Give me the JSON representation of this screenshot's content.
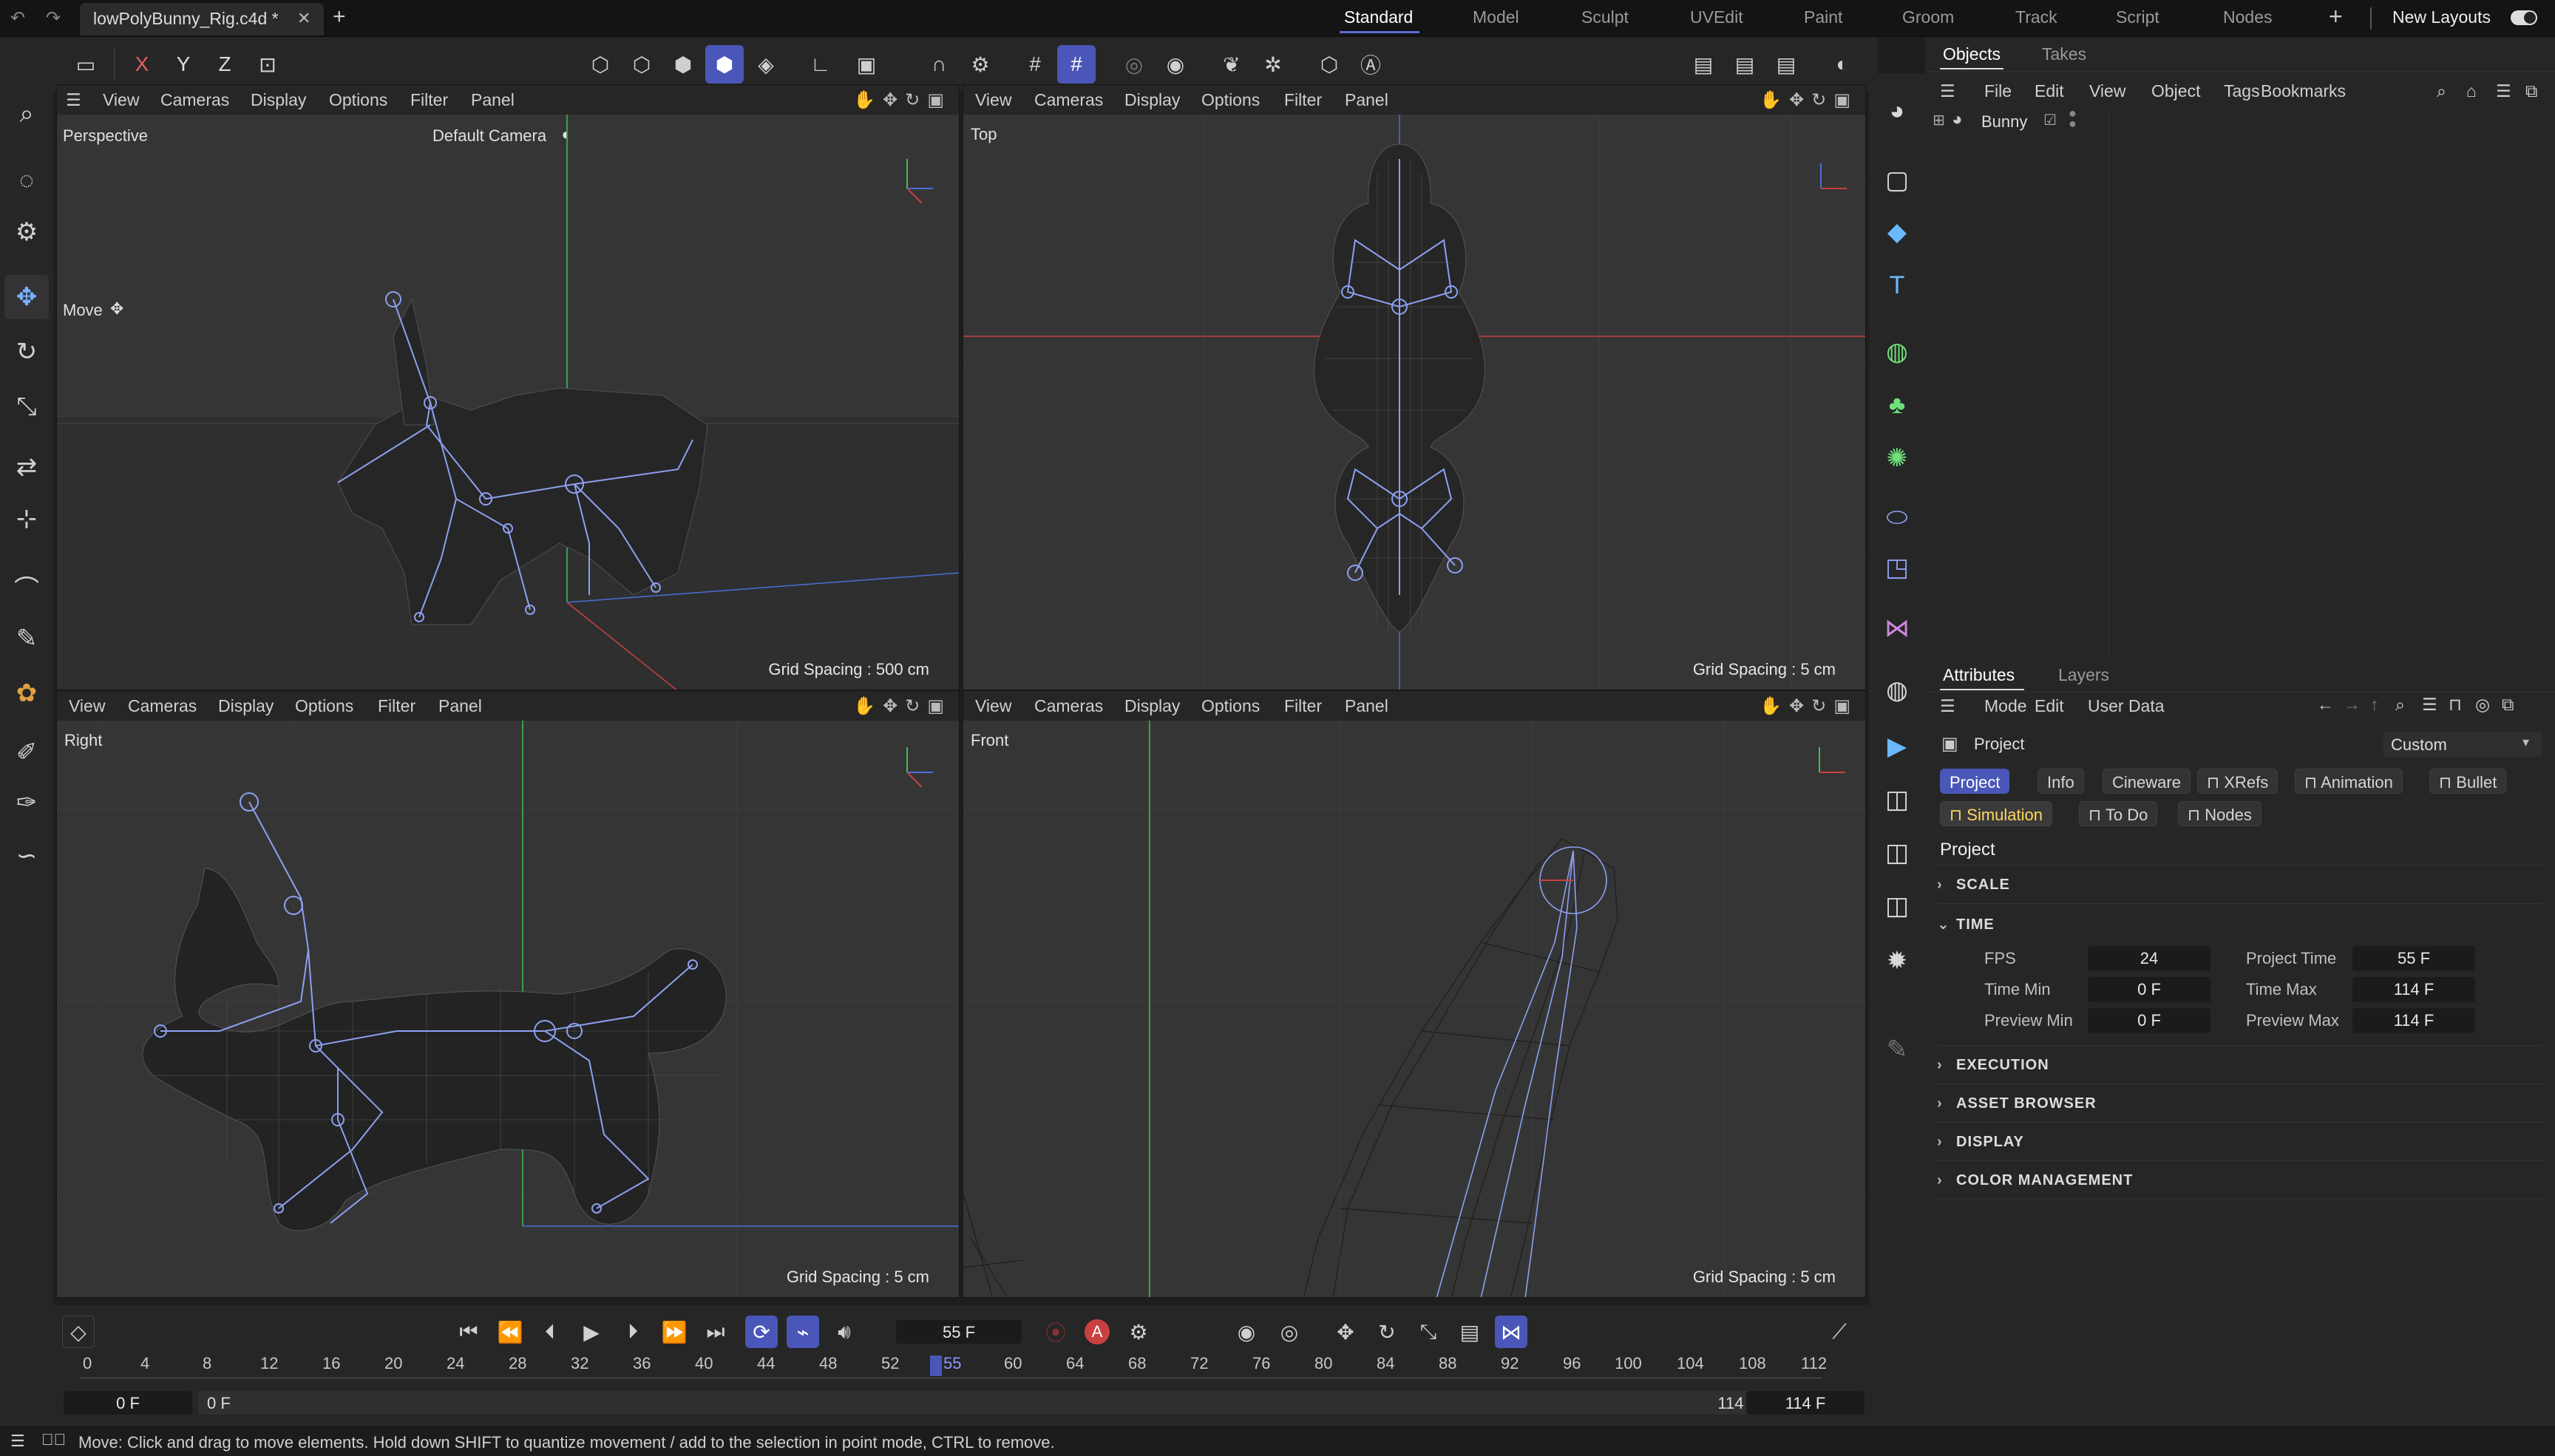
{
  "titlebar": {
    "doc_title": "lowPolyBunny_Rig.c4d *",
    "layouts": [
      "Standard",
      "Model",
      "Sculpt",
      "UVEdit",
      "Paint",
      "Groom",
      "Track",
      "Script",
      "Nodes"
    ],
    "active_layout": "Standard",
    "new_layouts_label": "New Layouts"
  },
  "toolbar": {
    "axes": [
      "X",
      "Y",
      "Z"
    ]
  },
  "left_tools": [
    "search-icon",
    "select-icon",
    "settings-icon",
    "move-icon",
    "rotate-icon",
    "scale-icon",
    "transform-icon",
    "snap-icon",
    "sculpt-icon",
    "knife-icon",
    "weight-icon",
    "paint-icon",
    "brush-icon",
    "spline-icon"
  ],
  "viewports": {
    "menu": [
      "View",
      "Cameras",
      "Display",
      "Options",
      "Filter",
      "Panel"
    ],
    "perspective": {
      "name": "Perspective",
      "camera": "Default Camera",
      "tool": "Move",
      "grid": "Grid Spacing : 500 cm"
    },
    "top": {
      "name": "Top",
      "grid": "Grid Spacing : 5 cm"
    },
    "right": {
      "name": "Right",
      "grid": "Grid Spacing : 5 cm"
    },
    "front": {
      "name": "Front",
      "grid": "Grid Spacing : 5 cm"
    }
  },
  "objects_panel": {
    "tabs": [
      "Objects",
      "Takes"
    ],
    "menu": [
      "File",
      "Edit",
      "View",
      "Object",
      "Tags",
      "Bookmarks"
    ],
    "tree": [
      {
        "name": "Bunny"
      }
    ]
  },
  "attributes_panel": {
    "tabs": [
      "Attributes",
      "Layers"
    ],
    "menu": [
      "Mode",
      "Edit",
      "User Data"
    ],
    "object_name": "Project",
    "preset": "Custom",
    "chips_row1": [
      "Project",
      "Info",
      "Cineware",
      "XRefs",
      "Animation",
      "Bullet"
    ],
    "chips_row2": [
      "Simulation",
      "To Do",
      "Nodes"
    ],
    "section_title": "Project",
    "sections": {
      "scale": "SCALE",
      "time": "TIME",
      "execution": "EXECUTION",
      "asset_browser": "ASSET BROWSER",
      "display": "DISPLAY",
      "color_management": "COLOR MANAGEMENT"
    },
    "time": {
      "fps_label": "FPS",
      "fps": "24",
      "project_time_label": "Project Time",
      "project_time": "55 F",
      "time_min_label": "Time Min",
      "time_min": "0 F",
      "time_max_label": "Time Max",
      "time_max": "114 F",
      "preview_min_label": "Preview Min",
      "preview_min": "0 F",
      "preview_max_label": "Preview Max",
      "preview_max": "114 F"
    }
  },
  "timeline": {
    "current_frame": "55 F",
    "ticks": [
      "0",
      "4",
      "8",
      "12",
      "16",
      "20",
      "24",
      "28",
      "32",
      "36",
      "40",
      "44",
      "48",
      "52",
      "55",
      "60",
      "64",
      "68",
      "72",
      "76",
      "80",
      "84",
      "88",
      "92",
      "96",
      "100",
      "104",
      "108",
      "112"
    ],
    "range_start": "0 F",
    "preview_start": "0 F",
    "preview_end": "114 F",
    "range_end": "114 F"
  },
  "statusbar": {
    "message": "Move: Click and drag to move elements. Hold down SHIFT to quantize movement / add to the selection in point mode, CTRL to remove."
  },
  "colors": {
    "accent": "#4a57b8",
    "x_axis": "#c94040",
    "y_axis": "#3fbf5a",
    "z_axis": "#4a6fd8",
    "rig": "#8da0f0"
  }
}
